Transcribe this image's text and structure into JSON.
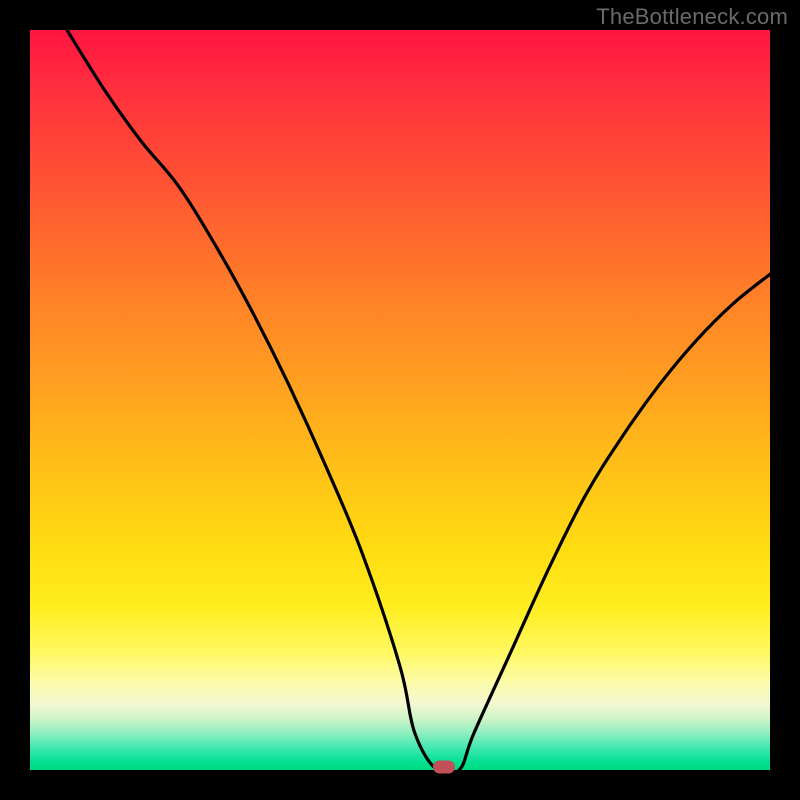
{
  "watermark": "TheBottleneck.com",
  "chart_data": {
    "type": "line",
    "title": "",
    "xlabel": "",
    "ylabel": "",
    "x_range": [
      0,
      100
    ],
    "y_range": [
      0,
      100
    ],
    "background_gradient": {
      "direction": "vertical",
      "stops": [
        {
          "pos": 0,
          "color": "#ff1440"
        },
        {
          "pos": 50,
          "color": "#ffb81c"
        },
        {
          "pos": 82,
          "color": "#fff060"
        },
        {
          "pos": 92,
          "color": "#e8f6c8"
        },
        {
          "pos": 100,
          "color": "#00d880"
        }
      ]
    },
    "series": [
      {
        "name": "bottleneck-curve",
        "color": "#000000",
        "x": [
          5,
          10,
          15,
          20,
          25,
          30,
          35,
          40,
          45,
          50,
          52,
          55,
          58,
          60,
          65,
          70,
          75,
          80,
          85,
          90,
          95,
          100
        ],
        "y": [
          100,
          92,
          85,
          79,
          71,
          62,
          52,
          41,
          29,
          14,
          5,
          0,
          0,
          5,
          16,
          27,
          37,
          45,
          52,
          58,
          63,
          67
        ]
      }
    ],
    "marker": {
      "name": "optimal-point",
      "x": 56,
      "y": 0,
      "color": "#c25058"
    }
  }
}
